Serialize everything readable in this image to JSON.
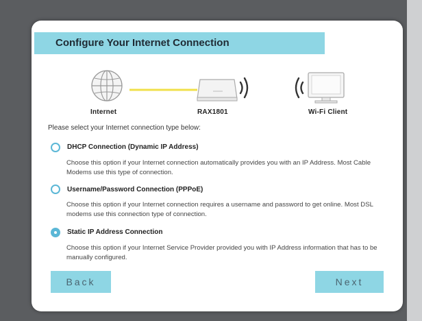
{
  "header": {
    "title": "Configure Your Internet Connection"
  },
  "diagram": {
    "internet_label": "Internet",
    "router_label": "RAX1801",
    "client_label": "Wi-Fi Client"
  },
  "instruction": "Please select your Internet connection type below:",
  "options": [
    {
      "label": "DHCP Connection (Dynamic IP Address)",
      "description": "Choose this option if your Internet connection automatically provides you with an IP Address. Most Cable Modems use this type of connection.",
      "selected": false
    },
    {
      "label": "Username/Password Connection (PPPoE)",
      "description": "Choose this option if your Internet connection requires a username and password to get online. Most DSL modems use this connection type of connection.",
      "selected": false
    },
    {
      "label": "Static IP Address Connection",
      "description": "Choose this option if your Internet Service Provider provided you with IP Address information that has to be manually configured.",
      "selected": true
    }
  ],
  "buttons": {
    "back": "Back",
    "next": "Next"
  },
  "colors": {
    "accent": "#8ed6e4",
    "radio": "#5bb7d6",
    "link_line": "#f0e04a"
  }
}
